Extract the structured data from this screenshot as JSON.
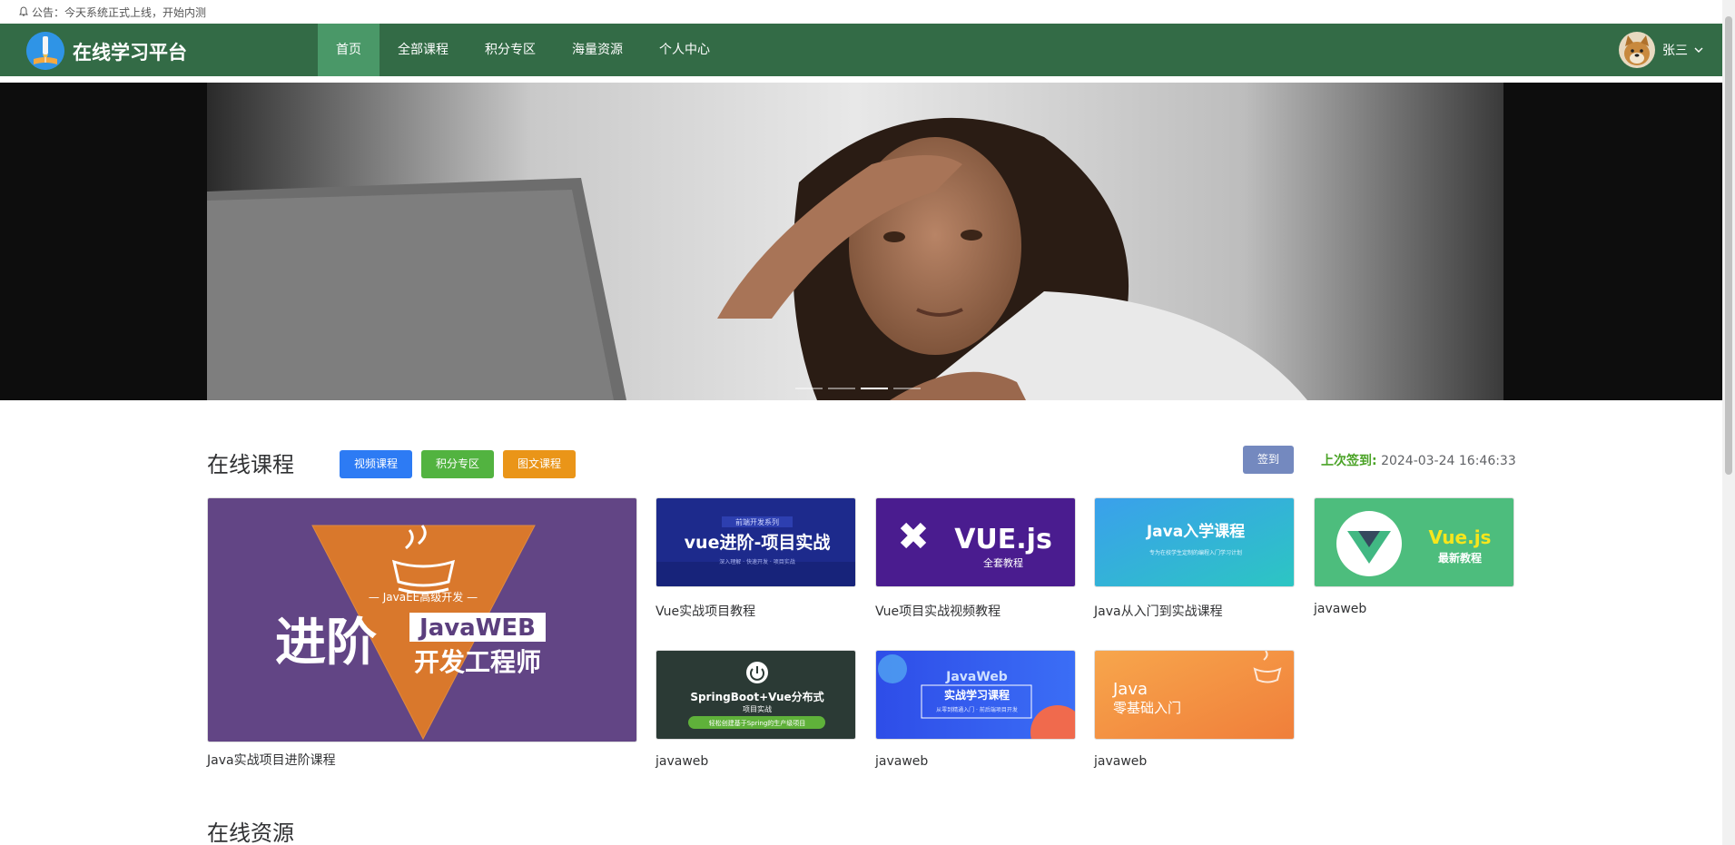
{
  "notice": {
    "text": "公告：今天系统正式上线，开始内测"
  },
  "header": {
    "brand": "在线学习平台",
    "nav": [
      {
        "label": "首页",
        "active": true
      },
      {
        "label": "全部课程",
        "active": false
      },
      {
        "label": "积分专区",
        "active": false
      },
      {
        "label": "海量资源",
        "active": false
      },
      {
        "label": "个人中心",
        "active": false
      }
    ],
    "user": {
      "name": "张三"
    }
  },
  "banner": {
    "slide_count": 4,
    "active_slide": 3
  },
  "courses": {
    "title": "在线课程",
    "filters": [
      "视频课程",
      "积分专区",
      "图文课程"
    ],
    "sign_button": "签到",
    "last_sign_label": "上次签到:",
    "last_sign_value": "2024-03-24 16:46:33",
    "featured": {
      "title": "Java实战项目进阶课程",
      "thumb": {
        "tagline": "— JavaEE高级开发 —",
        "big": "进阶",
        "line1": "JavaWEB",
        "line2": "开发工程师"
      }
    },
    "items": [
      {
        "title": "Vue实战项目教程",
        "thumb": {
          "tag": "前端开发系列",
          "text": "vue进阶-项目实战",
          "sub": "深入理解 · 快速开发 · 项目实战"
        }
      },
      {
        "title": "Vue项目实战视频教程",
        "thumb": {
          "text": "VUE.js",
          "sub": "全套教程"
        }
      },
      {
        "title": "Java从入门到实战课程",
        "thumb": {
          "text": "Java入学课程",
          "sub": "专为在校学生定制的编程入门学习计划"
        }
      },
      {
        "title": "javaweb",
        "thumb": {
          "text": "Vue.js",
          "sub": "最新教程"
        }
      },
      {
        "title": "javaweb",
        "thumb": {
          "text": "SpringBoot+Vue分布式",
          "sub": "项目实战",
          "tag": "轻松创建基于Spring的生产级项目"
        }
      },
      {
        "title": "javaweb",
        "thumb": {
          "text": "JavaWeb",
          "sub": "实战学习课程",
          "tag": "从零到精通入门 · 前后端项目开发"
        }
      },
      {
        "title": "javaweb",
        "thumb": {
          "text": "Java",
          "sub": "零基础入门"
        }
      }
    ]
  },
  "resources": {
    "title": "在线资源"
  }
}
